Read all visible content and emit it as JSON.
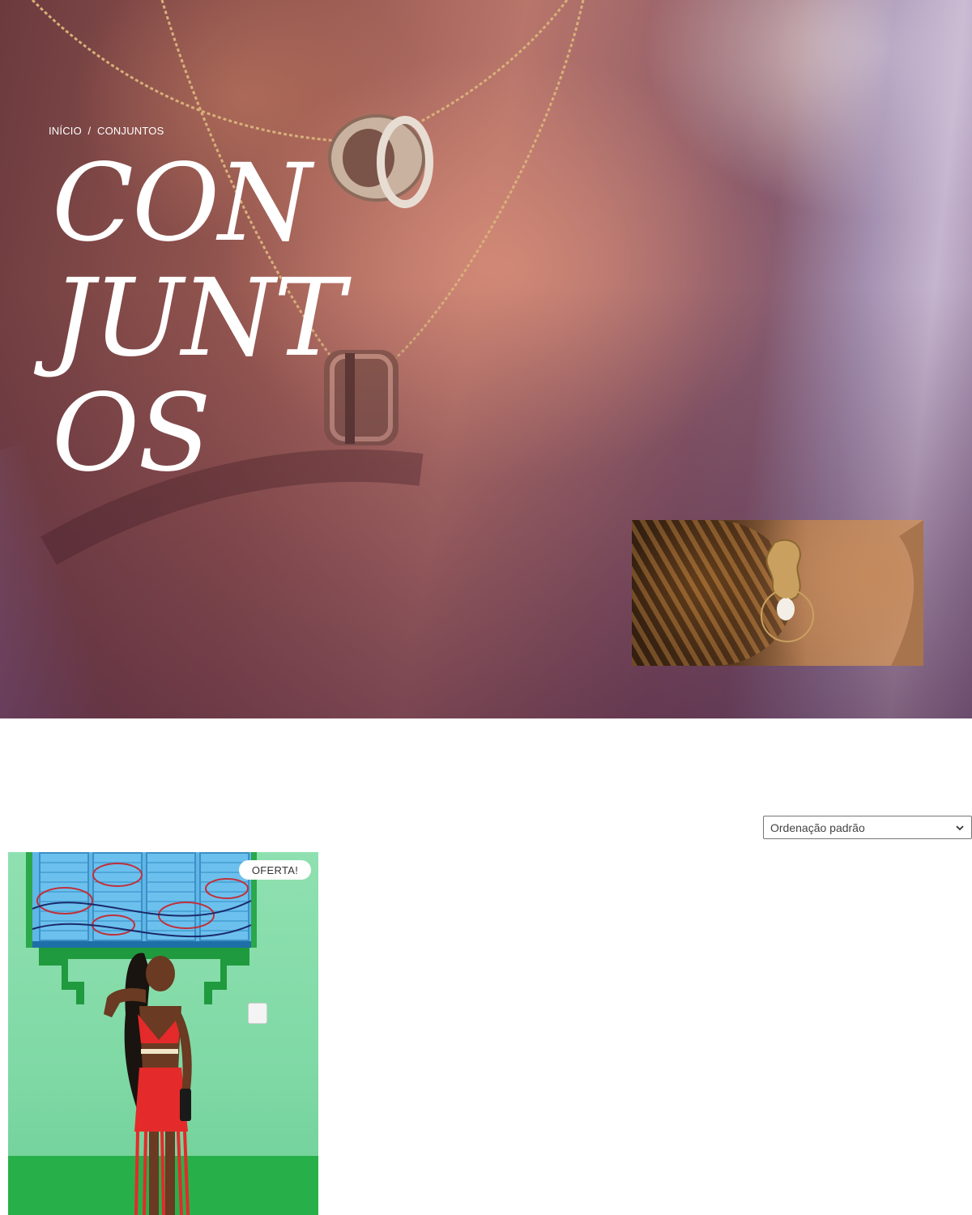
{
  "breadcrumb": {
    "home": "INÍCIO",
    "separator": "/",
    "current": "CONJUNTOS"
  },
  "hero": {
    "title": "CONJUNTOS"
  },
  "shop": {
    "sort": {
      "selected": "Ordenação padrão"
    },
    "products": [
      {
        "badge": "OFERTA!"
      }
    ]
  },
  "icons": {
    "sort_chevron": "chevron-down-icon"
  },
  "colors": {
    "hero_text": "#ffffff",
    "badge_bg": "#ffffff"
  }
}
